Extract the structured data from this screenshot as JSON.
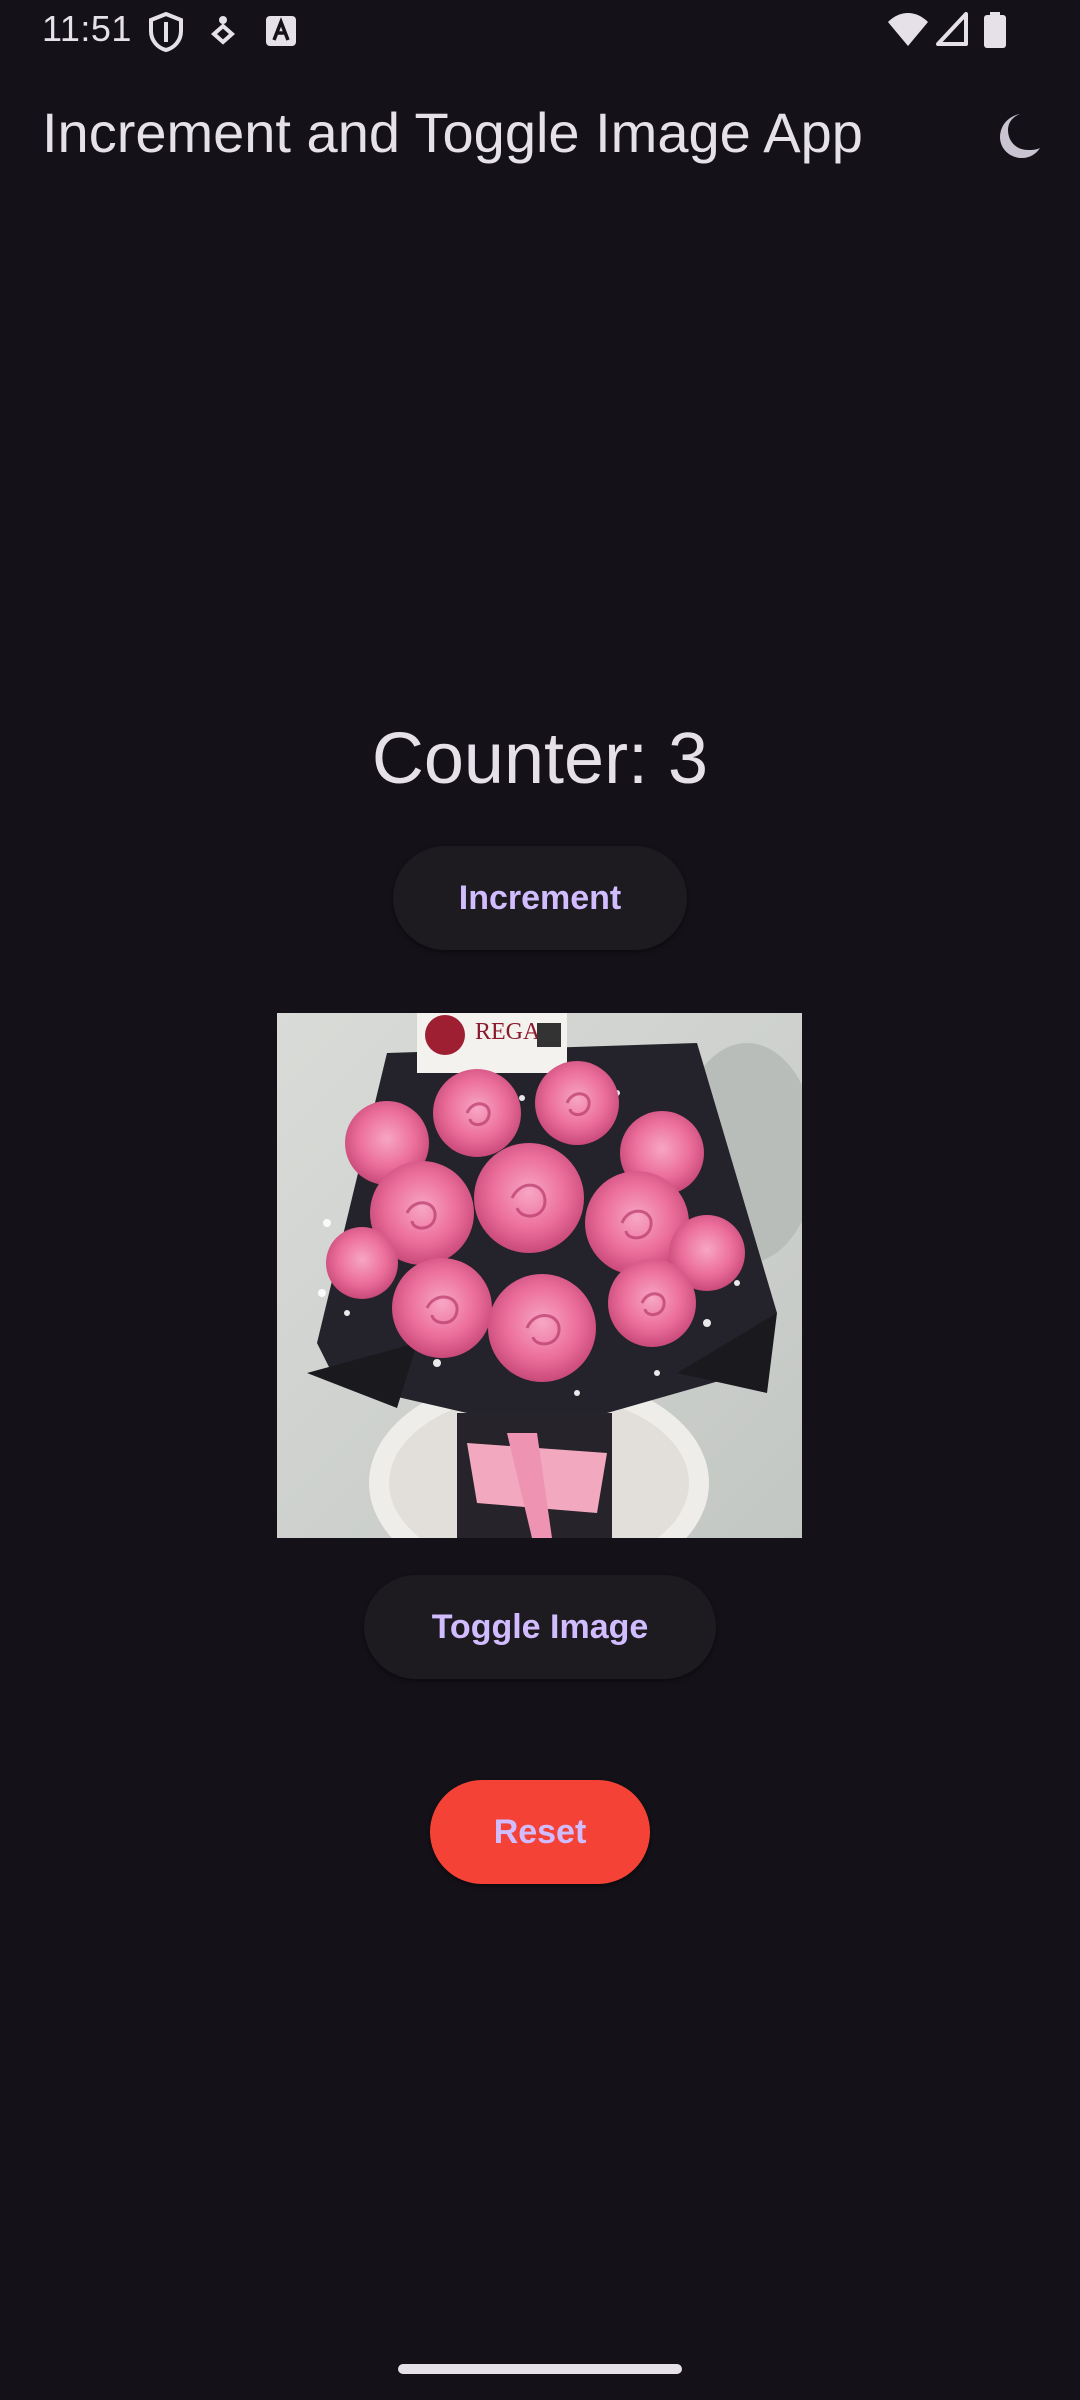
{
  "status_bar": {
    "time": "11:51",
    "icons_left": [
      "shield-icon",
      "accessibility-icon",
      "keyboard-a-icon"
    ],
    "icons_right": [
      "wifi-icon",
      "cell-signal-icon",
      "battery-icon"
    ]
  },
  "app_bar": {
    "title": "Increment and Toggle Image App",
    "theme_toggle_icon": "moon-icon"
  },
  "main": {
    "counter_label": "Counter: 3",
    "increment_label": "Increment",
    "toggle_image_label": "Toggle Image",
    "reset_label": "Reset",
    "image": {
      "subject": "pink-rose-bouquet",
      "card_text": "REGAL"
    }
  },
  "colors": {
    "background": "#141218",
    "button_surface": "#1D1B20",
    "button_text": "#D0BCFF",
    "reset_button": "#F44336",
    "on_surface": "#E6E0E9"
  }
}
